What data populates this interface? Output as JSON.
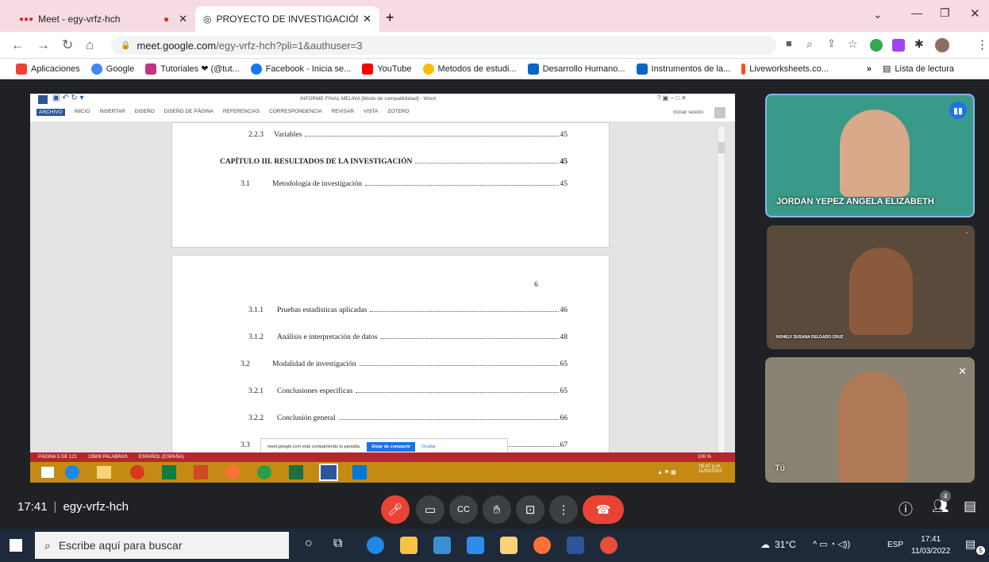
{
  "browser": {
    "tabs": [
      {
        "title": "Meet - egy-vrfz-hch",
        "recording_icon": "red-dot-icon"
      },
      {
        "title": "PROYECTO DE INVESTIGACIÓN F"
      }
    ],
    "new_tab_label": "+",
    "url_domain": "meet.google.com",
    "url_path": "/egy-vrfz-hch?pli=1&authuser=3",
    "bookmarks": [
      {
        "label": "Aplicaciones",
        "color": "#ea4335"
      },
      {
        "label": "Google",
        "color": "#4285f4"
      },
      {
        "label": "Tutoriales ❤ (@tut...",
        "color": "#c13584"
      },
      {
        "label": "Facebook - Inicia se...",
        "color": "#1877f2"
      },
      {
        "label": "YouTube",
        "color": "#ff0000"
      },
      {
        "label": "Metodos de estudi...",
        "color": "#fbbc04"
      },
      {
        "label": "Desarrollo Humano...",
        "color": "#0a66c2"
      },
      {
        "label": "Instrumentos de la...",
        "color": "#0a66c2"
      },
      {
        "label": "Liveworksheets.co...",
        "color": "#f4511e"
      }
    ],
    "more_bookmarks": "»",
    "reading_list": "Lista de lectura"
  },
  "word": {
    "title": "INFORME FINAL MELINA [Modo de compatibilidad] - Word",
    "sign_in": "Iniciar sesión",
    "menu": [
      "ARCHIVO",
      "INICIO",
      "INSERTAR",
      "DISEÑO",
      "DISEÑO DE PÁGINA",
      "REFERENCIAS",
      "CORRESPONDENCIA",
      "REVISAR",
      "VISTA",
      "ZOTERO"
    ],
    "page1": [
      {
        "num": "2.2.3",
        "text": "Variables",
        "page": "45"
      },
      {
        "num": "",
        "text": "CAPÍTULO III. RESULTADOS DE LA INVESTIGACIÓN",
        "page": "45"
      },
      {
        "num": "3.1",
        "text": "Metodología de investigación",
        "page": "45"
      }
    ],
    "page2_number": "6",
    "page2": [
      {
        "num": "3.1.1",
        "text": "Pruebas estadísticas aplicadas",
        "page": "46"
      },
      {
        "num": "3.1.2",
        "text": "Análisis e interpretación de datos",
        "page": "48"
      },
      {
        "num": "3.2",
        "text": "Modalidad de investigación",
        "page": "65"
      },
      {
        "num": "3.2.1",
        "text": "Conclusiones específicas",
        "page": "65"
      },
      {
        "num": "3.2.2",
        "text": "Conclusión general",
        "page": "66"
      },
      {
        "num": "3.3",
        "text": "",
        "page": "67"
      }
    ],
    "status": [
      "PÁGINA 5 DE 121",
      "19506 PALABRAS",
      "ESPAÑOL (ESPAÑA)"
    ],
    "zoom": "100 %",
    "share_notice": "meet.google.com está compartiendo tu pantalla.",
    "stop_share": "Dejar de compartir",
    "hide": "Ocultar",
    "inner_clock_time": "05:47 p.m.",
    "inner_clock_date": "11/03/2022"
  },
  "participants": [
    {
      "name": "JORDAN YEPEZ ANGELA ELIZABETH"
    },
    {
      "name": "NOHELY SUSANA DELGADO CRUZ"
    },
    {
      "name": "Tú"
    }
  ],
  "meet": {
    "time": "17:41",
    "separator": "|",
    "code": "egy-vrfz-hch",
    "people_count": "4"
  },
  "taskbar": {
    "search_placeholder": "Escribe aquí para buscar",
    "weather": "31°C",
    "lang": "ESP",
    "time": "17:41",
    "date": "11/03/2022",
    "notifications": "5"
  }
}
